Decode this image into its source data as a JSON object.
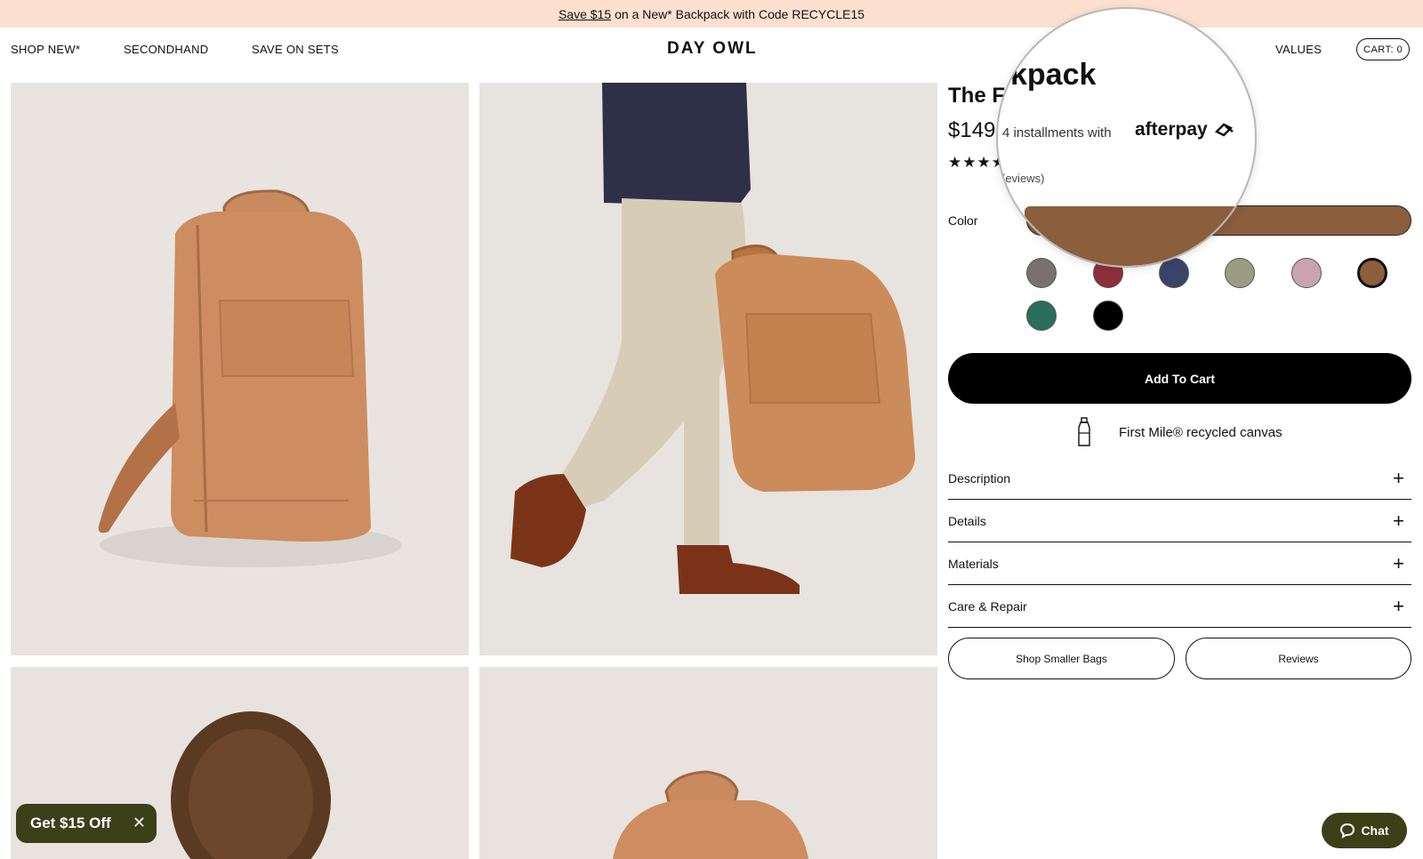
{
  "promo": {
    "link_text": "Save $15",
    "rest_text": "on a New* Backpack with Code RECYCLE15"
  },
  "nav": {
    "left": [
      {
        "label": "SHOP NEW*"
      },
      {
        "label": "SECONDHAND"
      },
      {
        "label": "SAVE ON SETS"
      }
    ],
    "logo": "DAY OWL",
    "right": [
      {
        "label": "VALUES"
      }
    ],
    "cart_label": "CART:",
    "cart_count": "0"
  },
  "product": {
    "title_visible": "The F",
    "price": "$149",
    "rating": "★★★★",
    "color_label": "Color",
    "swatches": [
      {
        "name": "gray",
        "color": "#78716f"
      },
      {
        "name": "burgundy",
        "color": "#8f2f3a"
      },
      {
        "name": "navy",
        "color": "#3a4468"
      },
      {
        "name": "sage",
        "color": "#9d9b82"
      },
      {
        "name": "mauve",
        "color": "#c9a3b0"
      },
      {
        "name": "brown",
        "color": "#8b5e3c"
      },
      {
        "name": "teal",
        "color": "#2b6e5e"
      },
      {
        "name": "black",
        "color": "#000000"
      }
    ],
    "selected_color": "#8b5e3c",
    "add_to_cart": "Add To Cart",
    "material_note": "First Mile® recycled canvas",
    "accordion": [
      {
        "label": "Description"
      },
      {
        "label": "Details"
      },
      {
        "label": "Materials"
      },
      {
        "label": "Care & Repair"
      }
    ],
    "buttons": {
      "shop_smaller": "Shop Smaller Bags",
      "reviews": "Reviews"
    }
  },
  "magnifier": {
    "title_fragment": "kpack",
    "installments": "4 installments with",
    "afterpay": "afterpay",
    "reviews_fragment": "(eviews)"
  },
  "floating": {
    "promo_chip": "Get $15 Off",
    "chat": "Chat"
  },
  "colors": {
    "promo_bg": "#fde0cf",
    "accent_dark": "#3b4018",
    "bag_tan": "#c98a5e"
  }
}
